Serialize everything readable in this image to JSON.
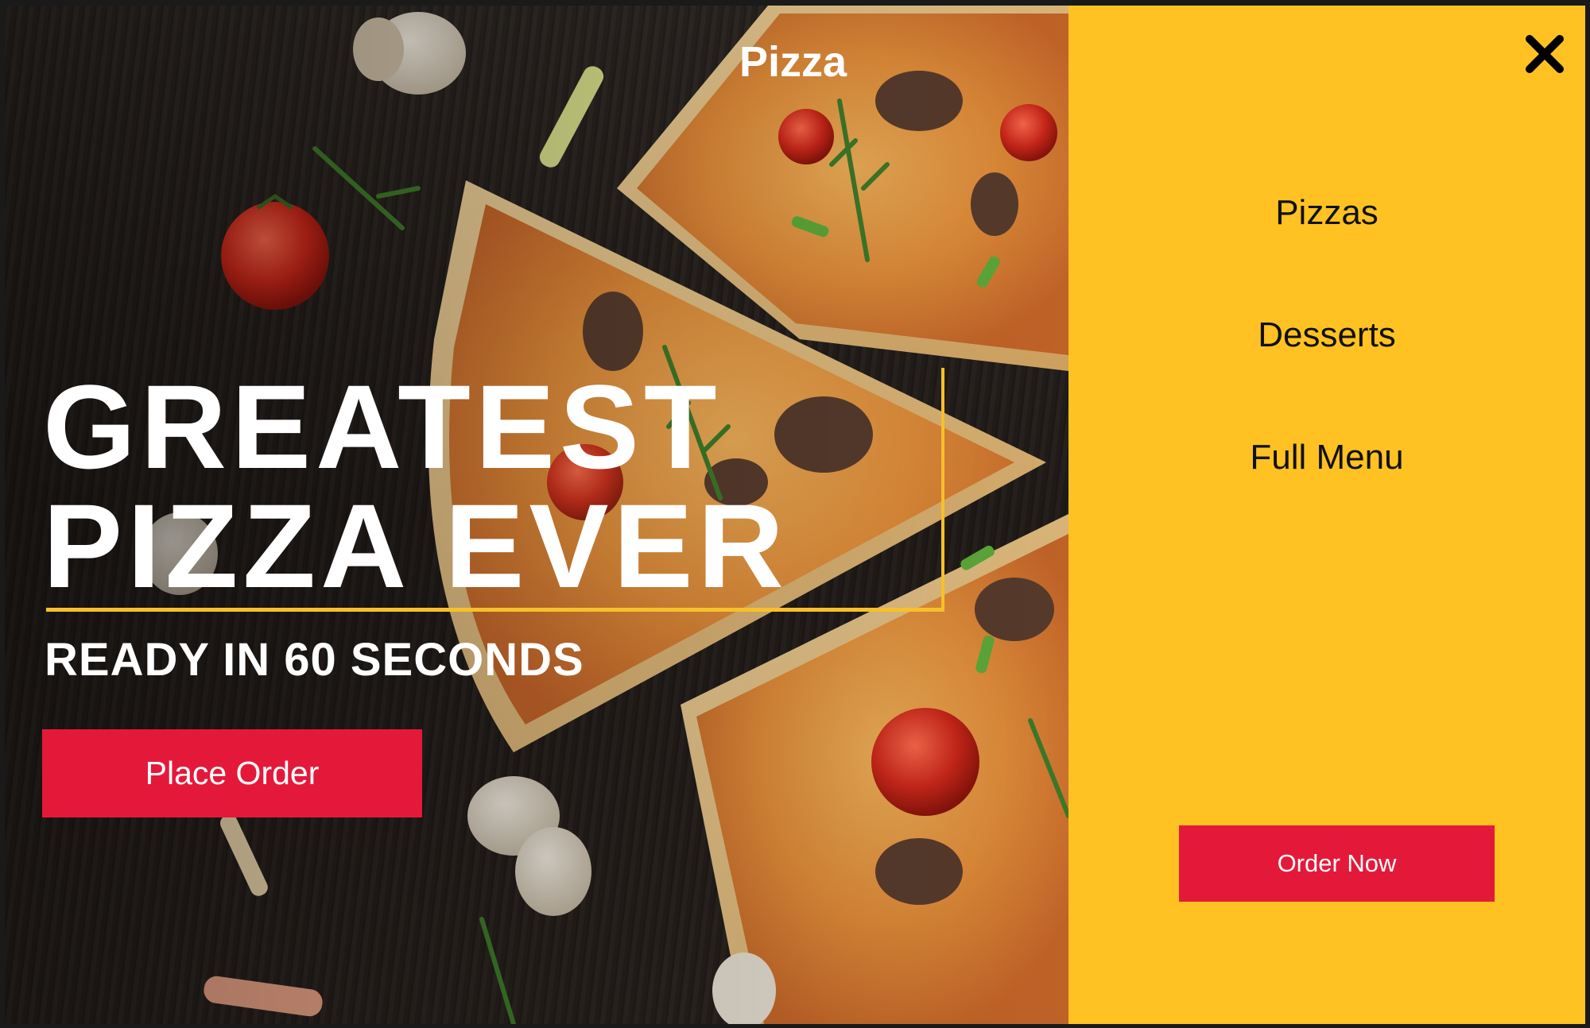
{
  "hero": {
    "brand": "Pizza",
    "headline_line1": "GREATEST",
    "headline_line2": "PIZZA EVER",
    "tagline": "READY IN 60 SECONDS",
    "cta_label": "Place Order",
    "image": "pizza-slices-photo"
  },
  "menu": {
    "close_icon": "close-icon",
    "items": [
      {
        "label": "Pizzas"
      },
      {
        "label": "Desserts"
      },
      {
        "label": "Full Menu"
      }
    ],
    "cta_label": "Order Now"
  },
  "colors": {
    "accent_yellow": "#ffc222",
    "accent_red": "#e4193a",
    "frame_line": "#f7c02a",
    "text_light": "#ffffff",
    "text_dark": "#111111"
  }
}
